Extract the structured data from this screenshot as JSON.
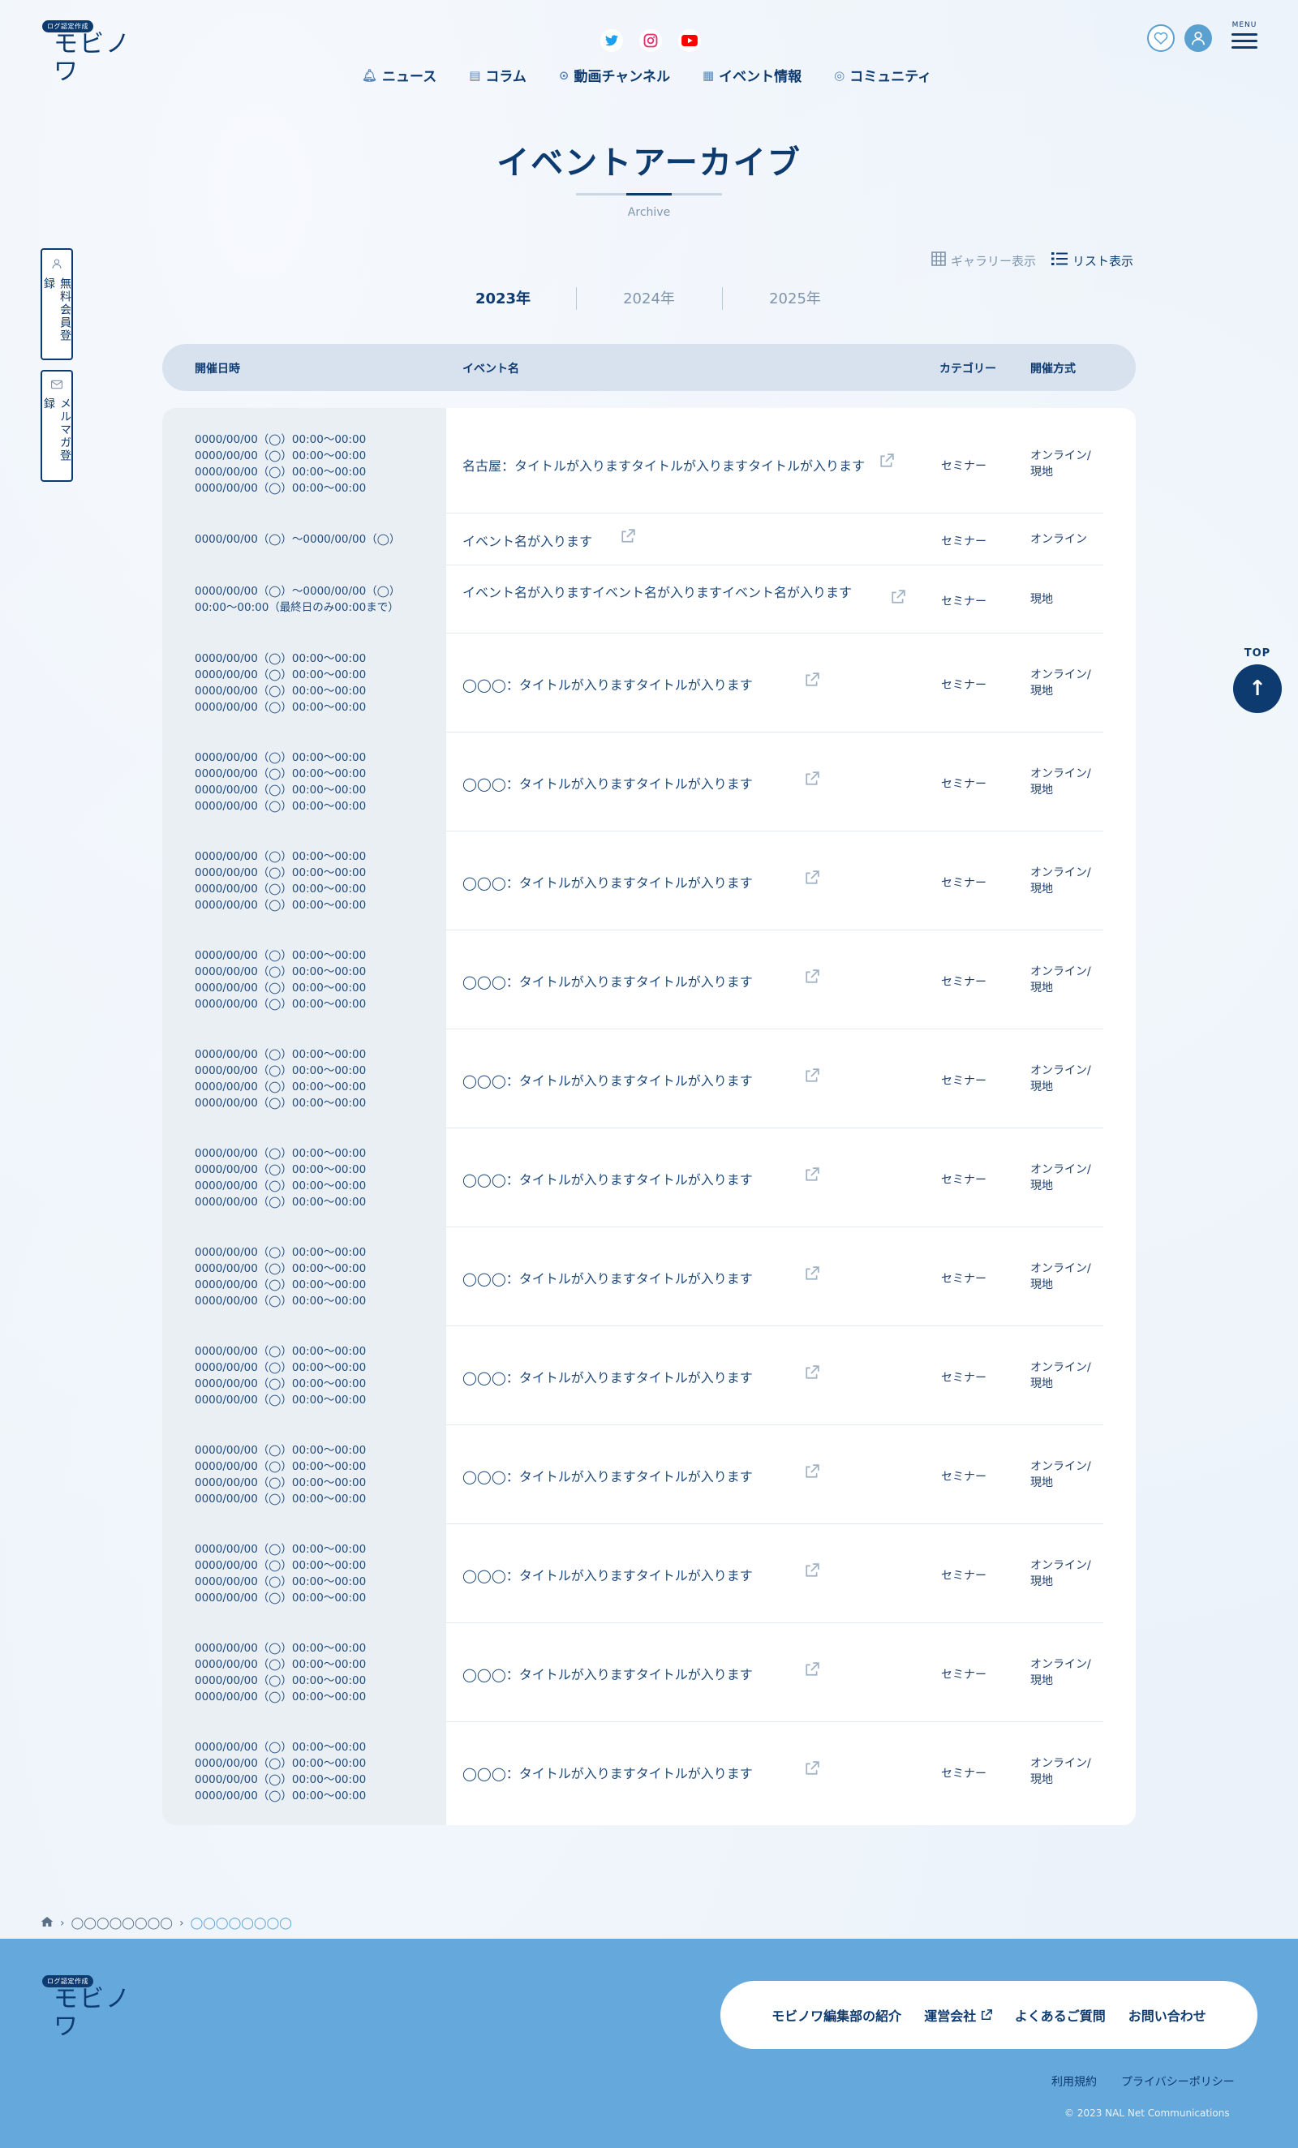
{
  "header": {
    "logo_badge": "ログ認定作成",
    "logo_word": "モビノワ",
    "nav": [
      {
        "label": "ニュース",
        "icon": "bell-icon"
      },
      {
        "label": "コラム",
        "icon": "document-icon"
      },
      {
        "label": "動画チャンネル",
        "icon": "play-icon"
      },
      {
        "label": "イベント情報",
        "icon": "calendar-icon"
      },
      {
        "label": "コミュニティ",
        "icon": "community-icon"
      }
    ],
    "menu_label": "MENU"
  },
  "page": {
    "title": "イベントアーカイブ",
    "subtitle": "Archive"
  },
  "side_buttons": {
    "register": "無料会員登録",
    "mailmag": "メルマガ登録"
  },
  "view_toggle": {
    "gallery": "ギャラリー表示",
    "list": "リスト表示"
  },
  "year_tabs": [
    "2023年",
    "2024年",
    "2025年"
  ],
  "table": {
    "headers": {
      "date": "開催日時",
      "name": "イベント名",
      "category": "カテゴリー",
      "method": "開催方式"
    },
    "rows": [
      {
        "date": [
          "0000/00/00（◯）00:00〜00:00",
          "0000/00/00（◯）00:00〜00:00",
          "0000/00/00（◯）00:00〜00:00",
          "0000/00/00（◯）00:00〜00:00"
        ],
        "name": "名古屋：タイトルが入りますタイトルが入りますタイトルが入ります",
        "category": "セミナー",
        "method": [
          "オンライン/",
          "現地"
        ]
      },
      {
        "date": [
          "0000/00/00（◯）〜0000/00/00（◯）"
        ],
        "name": "イベント名が入ります",
        "category": "セミナー",
        "method": [
          "オンライン"
        ]
      },
      {
        "date": [
          "0000/00/00（◯）〜0000/00/00（◯）",
          "00:00〜00:00（最終日のみ00:00まで）"
        ],
        "name": "イベント名が入りますイベント名が入りますイベント名が入ります",
        "category": "セミナー",
        "method": [
          "現地"
        ]
      },
      {
        "date": [
          "0000/00/00（◯）00:00〜00:00",
          "0000/00/00（◯）00:00〜00:00",
          "0000/00/00（◯）00:00〜00:00",
          "0000/00/00（◯）00:00〜00:00"
        ],
        "name": "◯◯◯：タイトルが入りますタイトルが入ります",
        "category": "セミナー",
        "method": [
          "オンライン/",
          "現地"
        ]
      },
      {
        "date": [
          "0000/00/00（◯）00:00〜00:00",
          "0000/00/00（◯）00:00〜00:00",
          "0000/00/00（◯）00:00〜00:00",
          "0000/00/00（◯）00:00〜00:00"
        ],
        "name": "◯◯◯：タイトルが入りますタイトルが入ります",
        "category": "セミナー",
        "method": [
          "オンライン/",
          "現地"
        ]
      },
      {
        "date": [
          "0000/00/00（◯）00:00〜00:00",
          "0000/00/00（◯）00:00〜00:00",
          "0000/00/00（◯）00:00〜00:00",
          "0000/00/00（◯）00:00〜00:00"
        ],
        "name": "◯◯◯：タイトルが入りますタイトルが入ります",
        "category": "セミナー",
        "method": [
          "オンライン/",
          "現地"
        ]
      },
      {
        "date": [
          "0000/00/00（◯）00:00〜00:00",
          "0000/00/00（◯）00:00〜00:00",
          "0000/00/00（◯）00:00〜00:00",
          "0000/00/00（◯）00:00〜00:00"
        ],
        "name": "◯◯◯：タイトルが入りますタイトルが入ります",
        "category": "セミナー",
        "method": [
          "オンライン/",
          "現地"
        ]
      },
      {
        "date": [
          "0000/00/00（◯）00:00〜00:00",
          "0000/00/00（◯）00:00〜00:00",
          "0000/00/00（◯）00:00〜00:00",
          "0000/00/00（◯）00:00〜00:00"
        ],
        "name": "◯◯◯：タイトルが入りますタイトルが入ります",
        "category": "セミナー",
        "method": [
          "オンライン/",
          "現地"
        ]
      },
      {
        "date": [
          "0000/00/00（◯）00:00〜00:00",
          "0000/00/00（◯）00:00〜00:00",
          "0000/00/00（◯）00:00〜00:00",
          "0000/00/00（◯）00:00〜00:00"
        ],
        "name": "◯◯◯：タイトルが入りますタイトルが入ります",
        "category": "セミナー",
        "method": [
          "オンライン/",
          "現地"
        ]
      },
      {
        "date": [
          "0000/00/00（◯）00:00〜00:00",
          "0000/00/00（◯）00:00〜00:00",
          "0000/00/00（◯）00:00〜00:00",
          "0000/00/00（◯）00:00〜00:00"
        ],
        "name": "◯◯◯：タイトルが入りますタイトルが入ります",
        "category": "セミナー",
        "method": [
          "オンライン/",
          "現地"
        ]
      },
      {
        "date": [
          "0000/00/00（◯）00:00〜00:00",
          "0000/00/00（◯）00:00〜00:00",
          "0000/00/00（◯）00:00〜00:00",
          "0000/00/00（◯）00:00〜00:00"
        ],
        "name": "◯◯◯：タイトルが入りますタイトルが入ります",
        "category": "セミナー",
        "method": [
          "オンライン/",
          "現地"
        ]
      },
      {
        "date": [
          "0000/00/00（◯）00:00〜00:00",
          "0000/00/00（◯）00:00〜00:00",
          "0000/00/00（◯）00:00〜00:00",
          "0000/00/00（◯）00:00〜00:00"
        ],
        "name": "◯◯◯：タイトルが入りますタイトルが入ります",
        "category": "セミナー",
        "method": [
          "オンライン/",
          "現地"
        ]
      },
      {
        "date": [
          "0000/00/00（◯）00:00〜00:00",
          "0000/00/00（◯）00:00〜00:00",
          "0000/00/00（◯）00:00〜00:00",
          "0000/00/00（◯）00:00〜00:00"
        ],
        "name": "◯◯◯：タイトルが入りますタイトルが入ります",
        "category": "セミナー",
        "method": [
          "オンライン/",
          "現地"
        ]
      },
      {
        "date": [
          "0000/00/00（◯）00:00〜00:00",
          "0000/00/00（◯）00:00〜00:00",
          "0000/00/00（◯）00:00〜00:00",
          "0000/00/00（◯）00:00〜00:00"
        ],
        "name": "◯◯◯：タイトルが入りますタイトルが入ります",
        "category": "セミナー",
        "method": [
          "オンライン/",
          "現地"
        ]
      },
      {
        "date": [
          "0000/00/00（◯）00:00〜00:00",
          "0000/00/00（◯）00:00〜00:00",
          "0000/00/00（◯）00:00〜00:00",
          "0000/00/00（◯）00:00〜00:00"
        ],
        "name": "◯◯◯：タイトルが入りますタイトルが入ります",
        "category": "セミナー",
        "method": [
          "オンライン/",
          "現地"
        ]
      }
    ]
  },
  "top_button": {
    "label": "TOP"
  },
  "breadcrumb": [
    "◯◯◯◯◯◯◯◯",
    "◯◯◯◯◯◯◯◯"
  ],
  "footer": {
    "logo_badge": "ログ認定作成",
    "logo_word": "モビノワ",
    "links": [
      "モビノワ編集部の紹介",
      "運営会社",
      "よくあるご質問",
      "お問い合わせ"
    ],
    "sub_links": [
      "利用規約",
      "プライバシーポリシー"
    ],
    "copyright": "© 2023 NAL Net Communications"
  },
  "colors": {
    "brand_navy": "#0e3b6f",
    "accent_blue": "#5aa0d0",
    "footer_blue": "#64a8dc",
    "twitter": "#1da1f2",
    "instagram": "#e1306c",
    "youtube": "#ff0000"
  }
}
